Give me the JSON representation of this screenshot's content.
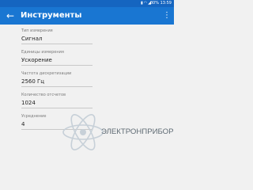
{
  "status_bar": {
    "icons": [
      "sim-icon",
      "wifi-icon",
      "signal-icon"
    ],
    "battery": "80%",
    "time": "13:59"
  },
  "app_bar": {
    "title": "Инструменты",
    "back_icon": "arrow-back-icon",
    "menu_icon": "more-vert-icon"
  },
  "fields": [
    {
      "label": "Тип измерения",
      "value": "Сигнал"
    },
    {
      "label": "Единицы измерения",
      "value": "Ускорение"
    },
    {
      "label": "Частота дискретизации",
      "value": "2560 Гц"
    },
    {
      "label": "Количество отсчетов",
      "value": "1024"
    },
    {
      "label": "Усреднение",
      "value": "4"
    }
  ],
  "watermark": {
    "text": "ЭЛЕКТРОНПРИБОР"
  },
  "colors": {
    "status_bar": "#1565c0",
    "app_bar": "#1976d2",
    "background": "#f1f1f1",
    "watermark": "#5e6a73"
  }
}
